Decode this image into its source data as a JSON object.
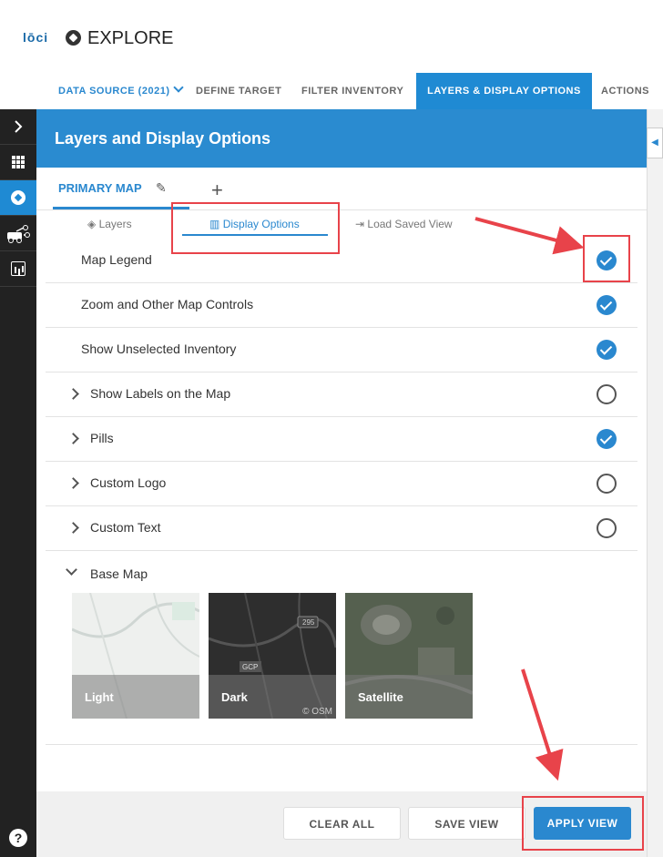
{
  "app": {
    "logo_text": "lōci",
    "title": "EXPLORE"
  },
  "nav": {
    "data_source": "DATA SOURCE (2021)",
    "define_target": "DEFINE TARGET",
    "filter_inventory": "FILTER INVENTORY",
    "layers_display": "LAYERS & DISPLAY OPTIONS",
    "actions": "ACTIONS"
  },
  "panel": {
    "title": "Layers and Display Options",
    "primary_map_tab": "PRIMARY MAP",
    "add_tab": "+"
  },
  "view_tabs": {
    "layers": "Layers",
    "display_options": "Display Options",
    "load_saved_view": "Load Saved View"
  },
  "options": [
    {
      "label": "Map Legend",
      "checked": true
    },
    {
      "label": "Zoom and Other Map Controls",
      "checked": true
    },
    {
      "label": "Show Unselected Inventory",
      "checked": true
    },
    {
      "label": "Show Labels on the Map",
      "checked": false
    },
    {
      "label": "Pills",
      "checked": true
    },
    {
      "label": "Custom Logo",
      "checked": false
    },
    {
      "label": "Custom Text",
      "checked": false
    }
  ],
  "base_map": {
    "label": "Base Map",
    "options": [
      "Light",
      "Dark",
      "Satellite"
    ],
    "dark_map_text": {
      "highway": "295",
      "place": "GCP",
      "attribution": "© OSM"
    }
  },
  "footer": {
    "clear_all": "CLEAR ALL",
    "save_view": "SAVE VIEW",
    "apply_view": "APPLY VIEW"
  },
  "colors": {
    "accent": "#2a88cf",
    "annotation": "#e8434a",
    "sidebar": "#222222"
  },
  "icons": [
    "compass-icon",
    "chevron-right-icon",
    "grid-icon",
    "route-icon",
    "bar-chart-icon",
    "help-icon",
    "pencil-icon",
    "layers-icon",
    "map-book-icon",
    "load-icon",
    "check-icon"
  ]
}
